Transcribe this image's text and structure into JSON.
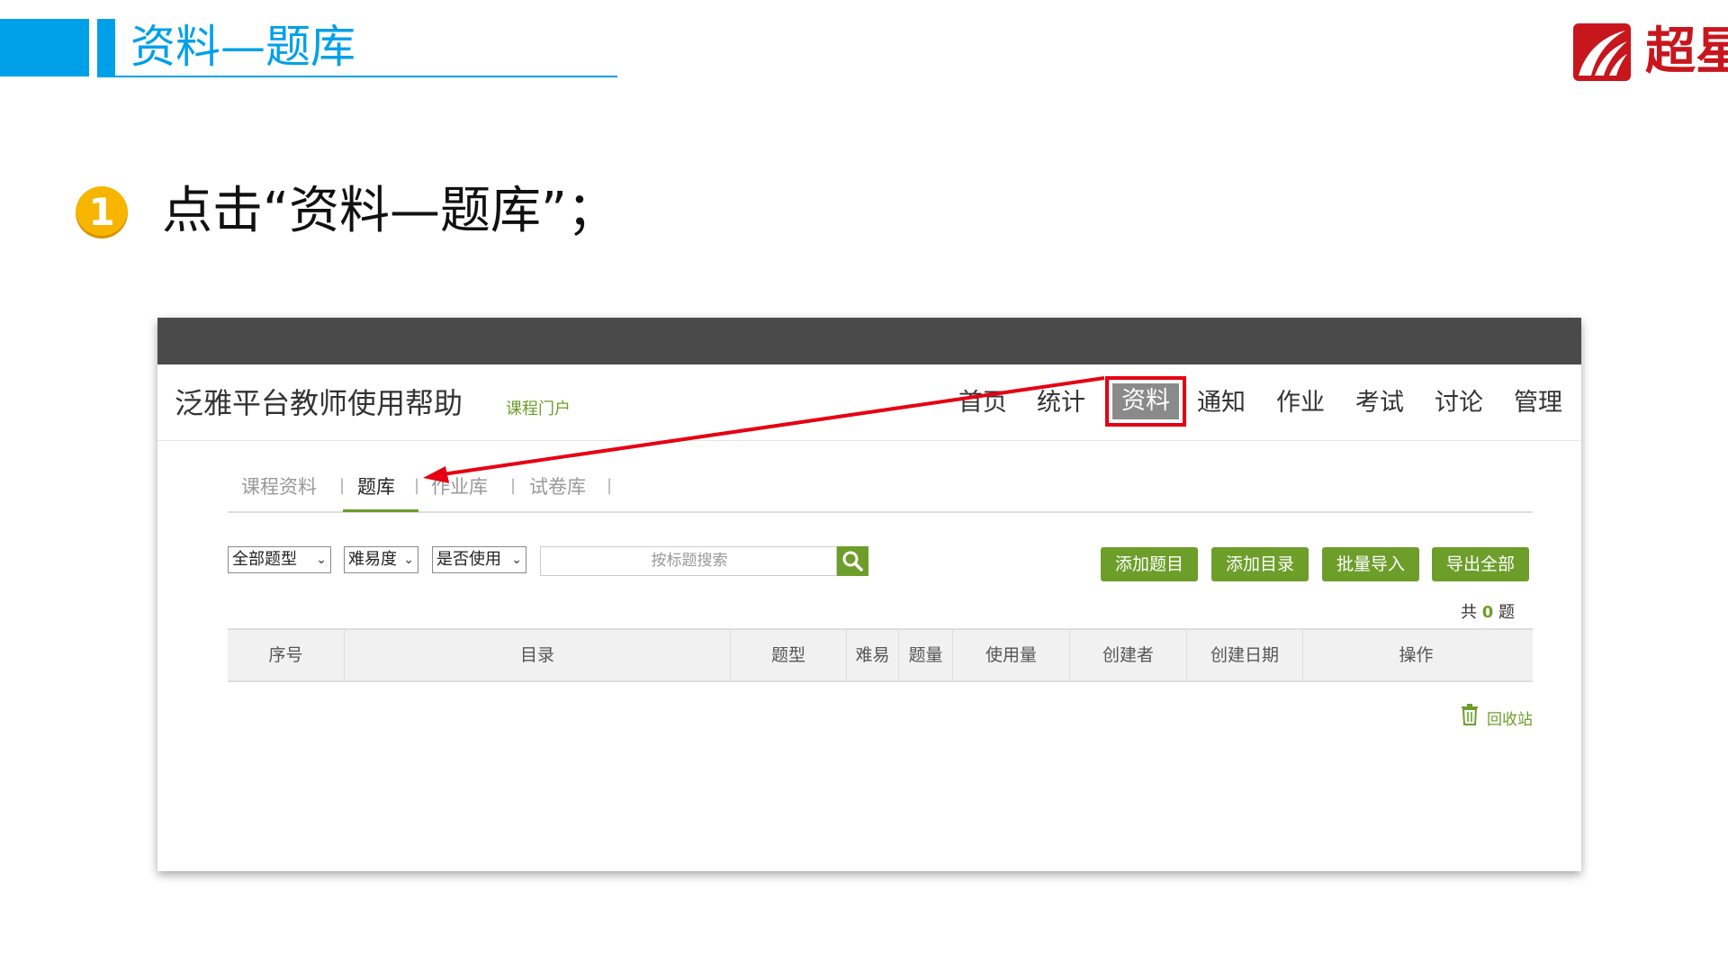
{
  "slide": {
    "title": "资料—题库",
    "logo_text": "超星",
    "step_number": "1",
    "step_text": "点击“资料—题库”；"
  },
  "site": {
    "title": "泛雅平台教师使用帮助",
    "portal_link": "课程门户"
  },
  "nav": {
    "items": [
      {
        "label": "首页"
      },
      {
        "label": "统计"
      },
      {
        "label": "资料"
      },
      {
        "label": "通知"
      },
      {
        "label": "作业"
      },
      {
        "label": "考试"
      },
      {
        "label": "讨论"
      },
      {
        "label": "管理"
      }
    ],
    "active": "资料"
  },
  "sub_tabs": [
    {
      "label": "课程资料"
    },
    {
      "label": "题库"
    },
    {
      "label": "作业库"
    },
    {
      "label": "试卷库"
    }
  ],
  "separator": "|",
  "filters": {
    "type": "全部题型",
    "difficulty": "难易度",
    "usage": "是否使用"
  },
  "search": {
    "placeholder": "按标题搜索"
  },
  "buttons": {
    "add_question": "添加题目",
    "add_catalog": "添加目录",
    "batch_import": "批量导入",
    "export_all": "导出全部"
  },
  "total": {
    "prefix": "共",
    "count": "0",
    "suffix": "题"
  },
  "table": {
    "columns": [
      "序号",
      "目录",
      "题型",
      "难易",
      "题量",
      "使用量",
      "创建者",
      "创建日期",
      "操作"
    ]
  },
  "recycle_label": "回收站",
  "colors": {
    "accent_blue": "#00a0e9",
    "green": "#6d9e2a",
    "highlight_red": "#e60012",
    "top_bar": "#4a4a4a",
    "logo_red": "#c8161d",
    "step_yellow": "#f7b500"
  }
}
